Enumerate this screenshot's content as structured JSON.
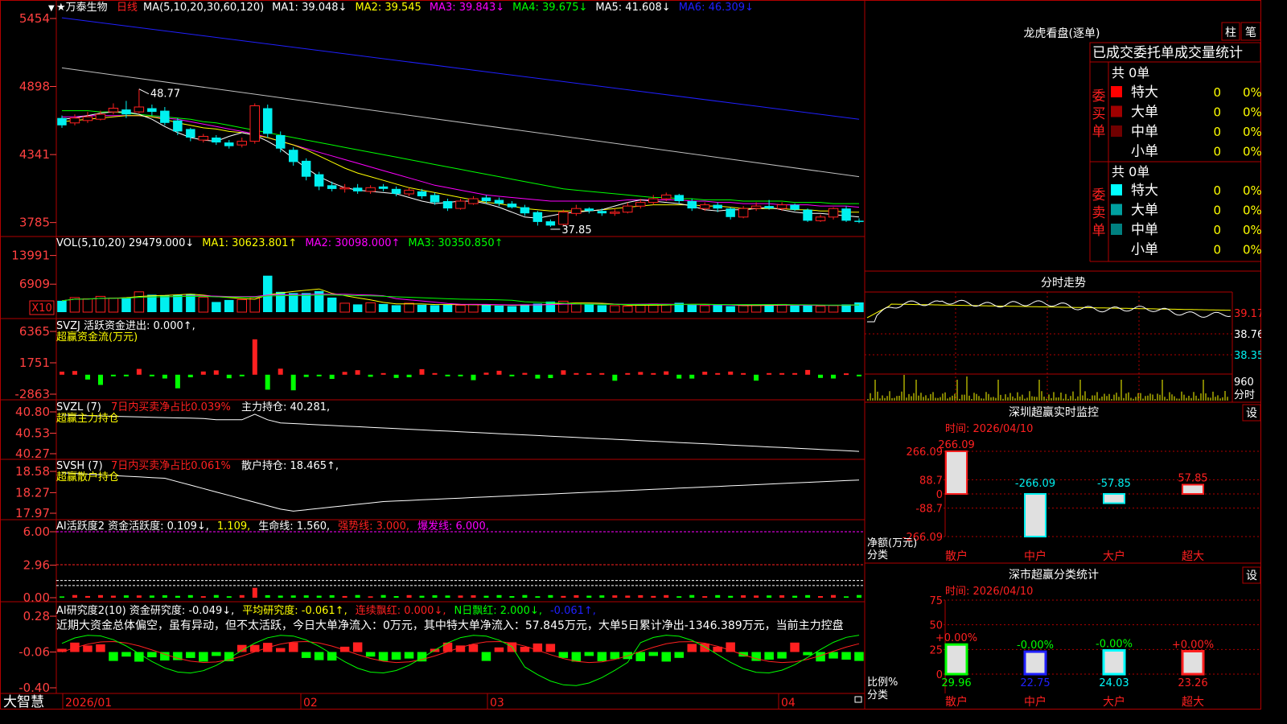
{
  "colors": {
    "up": "#ff2020",
    "down": "#00f0f0",
    "grid": "#b00000",
    "bg": "#000000",
    "white": "#ffffff",
    "yellow": "#ffff00",
    "magenta": "#ff00ff",
    "green": "#00ff00",
    "blue": "#2020ff",
    "gray": "#c0c0c0",
    "label": "#ff4040"
  },
  "brand": "大智慧",
  "main": {
    "stock": "★万泰生物",
    "period": "日线",
    "ma_legend": [
      {
        "text": "MA(5,10,20,30,60,120)",
        "color": "#ffffff"
      },
      {
        "text": "MA1: 39.048↓",
        "color": "#ffffff"
      },
      {
        "text": "MA2: 39.545",
        "color": "#ffff00"
      },
      {
        "text": "MA3: 39.843↓",
        "color": "#ff00ff"
      },
      {
        "text": "MA4: 39.675↓",
        "color": "#00ff00"
      },
      {
        "text": "MA5: 41.608↓",
        "color": "#ffffff"
      },
      {
        "text": "MA6: 46.309↓",
        "color": "#2020ff"
      }
    ],
    "high_label": "48.77",
    "low_label": "37.85"
  },
  "vol": {
    "legend": [
      {
        "text": "VOL(5,10,20) 29479.000↓",
        "color": "#ffffff"
      },
      {
        "text": "MA1: 30623.801↑",
        "color": "#ffff00"
      },
      {
        "text": "MA2: 30098.000↑",
        "color": "#ff00ff"
      },
      {
        "text": "MA3: 30350.850↑",
        "color": "#00ff00"
      }
    ],
    "unit": "X10"
  },
  "svzj": {
    "line1": "SVZJ  活跃资金进出: 0.000↑,",
    "line2": "超赢资金流(万元)"
  },
  "svzl": {
    "line1a": "SVZL (7)",
    "line1b": "7日内买卖净占比0.039%",
    "line1c": "主力持仓: 40.281,",
    "line2": "超赢主力持仓"
  },
  "svsh": {
    "line1a": "SVSH (7)",
    "line1b": "7日内买卖净占比0.061%",
    "line1c": "散户持仓: 18.465↑,",
    "line2": "超赢散户持仓"
  },
  "ai1": {
    "parts": [
      {
        "text": "AI活跃度2 资金活跃度: 0.109↓,",
        "color": "#ffffff"
      },
      {
        "text": "1.109,",
        "color": "#ffff00"
      },
      {
        "text": "生命线: 1.560,",
        "color": "#ffffff"
      },
      {
        "text": "强势线: 3.000,",
        "color": "#ff2020"
      },
      {
        "text": "爆发线: 6.000,",
        "color": "#ff00ff"
      }
    ]
  },
  "ai2": {
    "parts": [
      {
        "text": "AI研究度2(10) 资金研究度: -0.049↓,",
        "color": "#ffffff"
      },
      {
        "text": "平均研究度: -0.061↑,",
        "color": "#ffff00"
      },
      {
        "text": "连续飘红: 0.000↓,",
        "color": "#ff2020"
      },
      {
        "text": "N日飘红: 2.000↓,",
        "color": "#00ff00"
      },
      {
        "text": "-0.061↑,",
        "color": "#2020ff"
      }
    ],
    "note": "近期大资金总体偏空，虽有异动，但不太活跃，今日大单净流入：0万元，其中特大单净流入：57.845万元，大单5日累计净出-1346.389万元，当前主力控盘"
  },
  "axes": {
    "price": [
      "5454",
      "4898",
      "4341",
      "3785"
    ],
    "vol": [
      "13991",
      "6909"
    ],
    "svzj": [
      "6365",
      "1751",
      "-2863"
    ],
    "svzl": [
      "40.80",
      "40.53",
      "40.27"
    ],
    "svsh": [
      "18.58",
      "18.27",
      "17.97"
    ],
    "ai1": [
      "6.00",
      "2.96",
      "0.00"
    ],
    "ai2": [
      "0.28",
      "-0.06",
      "-0.40"
    ],
    "dates": [
      "2026/01",
      "02",
      "03",
      "04"
    ]
  },
  "lhb": {
    "title": "龙虎看盘(逐单)",
    "btn1": "柱",
    "btn2": "笔",
    "header": "已成交委托单成交量统计",
    "buy_label": "委买单",
    "sell_label": "委卖单",
    "buy_total": "共 0单",
    "sell_total": "共 0单",
    "buy_rows": [
      {
        "name": "特大",
        "v": "0",
        "p": "0%",
        "c": "#ff0000"
      },
      {
        "name": "大单",
        "v": "0",
        "p": "0%",
        "c": "#a00000"
      },
      {
        "name": "中单",
        "v": "0",
        "p": "0%",
        "c": "#700000"
      },
      {
        "name": "小单",
        "v": "0",
        "p": "0%",
        "c": ""
      }
    ],
    "sell_rows": [
      {
        "name": "特大",
        "v": "0",
        "p": "0%",
        "c": "#00ffff"
      },
      {
        "name": "大单",
        "v": "0",
        "p": "0%",
        "c": "#00a0a0"
      },
      {
        "name": "中单",
        "v": "0",
        "p": "0%",
        "c": "#008080"
      },
      {
        "name": "小单",
        "v": "0",
        "p": "0%",
        "c": ""
      }
    ]
  },
  "fenshi": {
    "title": "分时走势",
    "price_labels": [
      "39.17",
      "38.76",
      "38.35"
    ],
    "vol_label": "960",
    "vol_unit": "分时"
  },
  "sz_monitor": {
    "title": "深圳超赢实时监控",
    "btn": "设",
    "time": "时间: 2026/04/10",
    "y_labels": [
      "266.09",
      "88.7",
      "0",
      "-88.7",
      "-266.09"
    ],
    "footer1": "净额(万元)",
    "footer2": "分类",
    "categories": [
      "散户",
      "中户",
      "大户",
      "超大"
    ],
    "values": [
      266.09,
      -266.09,
      -57.85,
      57.85
    ],
    "value_labels": [
      "266.09",
      "-266.09",
      "-57.85",
      "57.85"
    ]
  },
  "sz_classify": {
    "title": "深市超赢分类统计",
    "btn": "设",
    "time": "时间: 2026/04/10",
    "y_labels": [
      "75",
      "50",
      "25",
      "0"
    ],
    "footer1": "比例%",
    "footer2": "分类",
    "categories": [
      "散户",
      "中户",
      "大户",
      "超大"
    ],
    "values": [
      29.96,
      22.75,
      24.03,
      23.26
    ],
    "value_labels": [
      "29.96",
      "22.75",
      "24.03",
      "23.26"
    ],
    "change_labels": [
      "+0.00%",
      "-0.00%",
      "-0.00%",
      "+0.00%"
    ]
  },
  "chart_data": [
    {
      "type": "candlestick",
      "y_range": [
        37.3,
        55.0
      ],
      "x": [
        "2026/01",
        "02",
        "03",
        "04"
      ],
      "candles": [
        [
          46.4,
          45.8,
          46.6,
          45.6
        ],
        [
          46.0,
          46.4,
          46.7,
          45.8
        ],
        [
          46.2,
          46.5,
          46.9,
          46.0
        ],
        [
          46.3,
          46.7,
          47.0,
          46.2
        ],
        [
          46.9,
          47.2,
          47.6,
          46.7
        ],
        [
          47.1,
          46.7,
          47.8,
          46.4
        ],
        [
          46.9,
          47.3,
          48.77,
          46.8
        ],
        [
          47.2,
          46.9,
          47.5,
          46.6
        ],
        [
          47.0,
          46.0,
          47.3,
          45.8
        ],
        [
          46.2,
          45.3,
          46.4,
          45.0
        ],
        [
          45.5,
          44.8,
          45.6,
          44.5
        ],
        [
          44.6,
          44.9,
          45.1,
          44.4
        ],
        [
          44.8,
          44.4,
          45.0,
          44.2
        ],
        [
          44.4,
          44.1,
          44.6,
          43.9
        ],
        [
          44.2,
          44.5,
          44.8,
          44.0
        ],
        [
          44.5,
          47.4,
          47.6,
          44.3
        ],
        [
          47.2,
          45.1,
          47.5,
          44.8
        ],
        [
          45.0,
          43.9,
          45.3,
          43.6
        ],
        [
          43.8,
          42.8,
          44.0,
          42.5
        ],
        [
          42.9,
          41.6,
          43.1,
          41.3
        ],
        [
          41.8,
          40.8,
          42.0,
          40.5
        ],
        [
          40.9,
          40.6,
          41.2,
          40.4
        ],
        [
          40.6,
          40.7,
          41.0,
          40.3
        ],
        [
          40.7,
          40.4,
          41.0,
          40.2
        ],
        [
          40.4,
          40.7,
          40.9,
          40.2
        ],
        [
          40.8,
          40.6,
          41.0,
          40.4
        ],
        [
          40.6,
          40.2,
          40.8,
          40.0
        ],
        [
          40.2,
          40.5,
          40.7,
          40.0
        ],
        [
          40.4,
          40.0,
          40.6,
          39.8
        ],
        [
          40.1,
          39.5,
          40.3,
          39.3
        ],
        [
          39.6,
          39.0,
          39.8,
          38.8
        ],
        [
          39.0,
          39.6,
          39.8,
          38.9
        ],
        [
          39.4,
          39.8,
          40.0,
          39.3
        ],
        [
          39.9,
          39.6,
          40.1,
          39.4
        ],
        [
          39.7,
          39.4,
          39.9,
          39.2
        ],
        [
          39.4,
          39.1,
          39.6,
          39.0
        ],
        [
          39.1,
          38.6,
          39.3,
          38.4
        ],
        [
          38.7,
          37.9,
          38.8,
          37.6
        ],
        [
          37.95,
          37.6,
          38.1,
          37.5
        ],
        [
          37.7,
          38.7,
          38.9,
          37.6
        ],
        [
          38.6,
          39.0,
          39.3,
          38.4
        ],
        [
          39.0,
          38.8,
          39.1,
          38.6
        ],
        [
          38.8,
          38.6,
          39.0,
          38.4
        ],
        [
          38.6,
          38.7,
          39.0,
          38.4
        ],
        [
          38.7,
          39.2,
          39.5,
          38.6
        ],
        [
          39.2,
          39.5,
          39.8,
          39.0
        ],
        [
          39.5,
          39.8,
          40.1,
          39.3
        ],
        [
          39.8,
          40.1,
          40.3,
          39.6
        ],
        [
          40.1,
          39.6,
          40.2,
          39.4
        ],
        [
          39.6,
          39.0,
          39.8,
          38.8
        ],
        [
          39.0,
          39.3,
          39.5,
          38.8
        ],
        [
          39.3,
          39.0,
          39.5,
          38.7
        ],
        [
          39.0,
          38.3,
          39.1,
          38.1
        ],
        [
          38.3,
          39.0,
          39.2,
          38.2
        ],
        [
          39.0,
          39.2,
          39.5,
          38.8
        ],
        [
          39.2,
          39.0,
          39.7,
          38.9
        ],
        [
          39.0,
          39.3,
          39.5,
          38.8
        ],
        [
          39.3,
          38.9,
          39.4,
          38.8
        ],
        [
          38.9,
          38.0,
          39.0,
          37.9
        ],
        [
          38.0,
          38.3,
          38.5,
          37.9
        ],
        [
          38.3,
          39.0,
          39.1,
          38.1
        ],
        [
          39.0,
          38.0,
          39.2,
          37.9
        ],
        [
          38.0,
          37.9,
          38.2,
          37.8
        ]
      ],
      "ma5": [
        46.3,
        46.4,
        46.6,
        46.8,
        46.9,
        46.9,
        46.7,
        46.3,
        45.7,
        45.2,
        44.8,
        44.6,
        44.5,
        44.9,
        45.2,
        45.0,
        44.5,
        43.9,
        43.1,
        42.3,
        41.6,
        41.1,
        40.7,
        40.5,
        40.4,
        40.3,
        40.2,
        39.9,
        39.6,
        39.4,
        39.5,
        39.6,
        39.6,
        39.4,
        39.1,
        38.7,
        38.3,
        38.2,
        38.4,
        38.6,
        38.7,
        38.8,
        38.9,
        39.2,
        39.5,
        39.7,
        39.6,
        39.5,
        39.4,
        39.2,
        38.9,
        38.8,
        38.9,
        38.9,
        39.0,
        39.1,
        38.9,
        38.7,
        38.6,
        38.6,
        38.5,
        38.4,
        38.3
      ],
      "ma10": [
        46.1,
        46.2,
        46.3,
        46.4,
        46.5,
        46.6,
        46.6,
        46.5,
        46.3,
        46.0,
        45.8,
        45.6,
        45.5,
        45.3,
        45.2,
        45.0,
        44.8,
        44.5,
        44.2,
        43.8,
        43.3,
        42.8,
        42.3,
        41.9,
        41.6,
        41.3,
        41.0,
        40.7,
        40.5,
        40.3,
        40.1,
        39.9,
        39.7,
        39.5,
        39.4,
        39.2,
        39.0,
        38.9,
        38.8,
        38.8,
        38.8,
        38.8,
        38.9,
        39.0,
        39.1,
        39.2,
        39.3,
        39.3,
        39.3,
        39.3,
        39.2,
        39.2,
        39.1,
        39.0,
        39.0,
        39.0,
        39.0,
        38.9,
        38.9,
        38.8,
        38.8,
        38.7,
        38.7
      ],
      "ma20": [
        46.5,
        46.5,
        46.6,
        46.6,
        46.6,
        46.6,
        46.6,
        46.5,
        46.4,
        46.3,
        46.1,
        45.9,
        45.7,
        45.5,
        45.3,
        45.1,
        44.8,
        44.5,
        44.2,
        43.9,
        43.6,
        43.3,
        43.0,
        42.7,
        42.4,
        42.1,
        41.8,
        41.5,
        41.2,
        40.9,
        40.7,
        40.5,
        40.3,
        40.1,
        40.0,
        39.9,
        39.8,
        39.7,
        39.6,
        39.6,
        39.6,
        39.6,
        39.6,
        39.6,
        39.7,
        39.7,
        39.7,
        39.7,
        39.7,
        39.6,
        39.6,
        39.5,
        39.5,
        39.4,
        39.4,
        39.4,
        39.3,
        39.3,
        39.3,
        39.2,
        39.2,
        39.2,
        39.1
      ],
      "ma30": [
        47.0,
        47.0,
        47.0,
        46.9,
        46.9,
        46.8,
        46.7,
        46.6,
        46.5,
        46.4,
        46.3,
        46.1,
        46.0,
        45.8,
        45.6,
        45.4,
        45.2,
        45.0,
        44.8,
        44.6,
        44.4,
        44.2,
        44.0,
        43.8,
        43.6,
        43.4,
        43.2,
        43.0,
        42.8,
        42.6,
        42.4,
        42.2,
        42.0,
        41.8,
        41.6,
        41.4,
        41.2,
        41.0,
        40.8,
        40.6,
        40.5,
        40.4,
        40.3,
        40.2,
        40.1,
        40.0,
        39.9,
        39.9,
        39.8,
        39.8,
        39.7,
        39.7,
        39.7,
        39.6,
        39.6,
        39.6,
        39.6,
        39.5,
        39.5,
        39.5,
        39.4,
        39.4,
        39.4
      ],
      "ma60_range": [
        50.5,
        41.6
      ],
      "ma120_range": [
        54.6,
        46.3
      ]
    },
    {
      "type": "bar",
      "name": "VOL",
      "y_range": [
        0,
        15500
      ],
      "values": [
        2800,
        3600,
        3300,
        3900,
        3500,
        3600,
        5000,
        4300,
        4200,
        4300,
        4500,
        3700,
        2500,
        3000,
        3100,
        3600,
        9000,
        5000,
        4700,
        4700,
        5200,
        3600,
        2200,
        1900,
        2300,
        2000,
        1700,
        2200,
        1800,
        1700,
        1900,
        1700,
        1900,
        1800,
        1600,
        1500,
        1900,
        2100,
        2600,
        2700,
        2000,
        1900,
        1700,
        1600,
        1500,
        1700,
        2000,
        1900,
        2300,
        1800,
        1600,
        1700,
        1500,
        1600,
        1700,
        1800,
        1900,
        1600,
        1700,
        1500,
        1600,
        1900,
        2400
      ]
    }
  ]
}
